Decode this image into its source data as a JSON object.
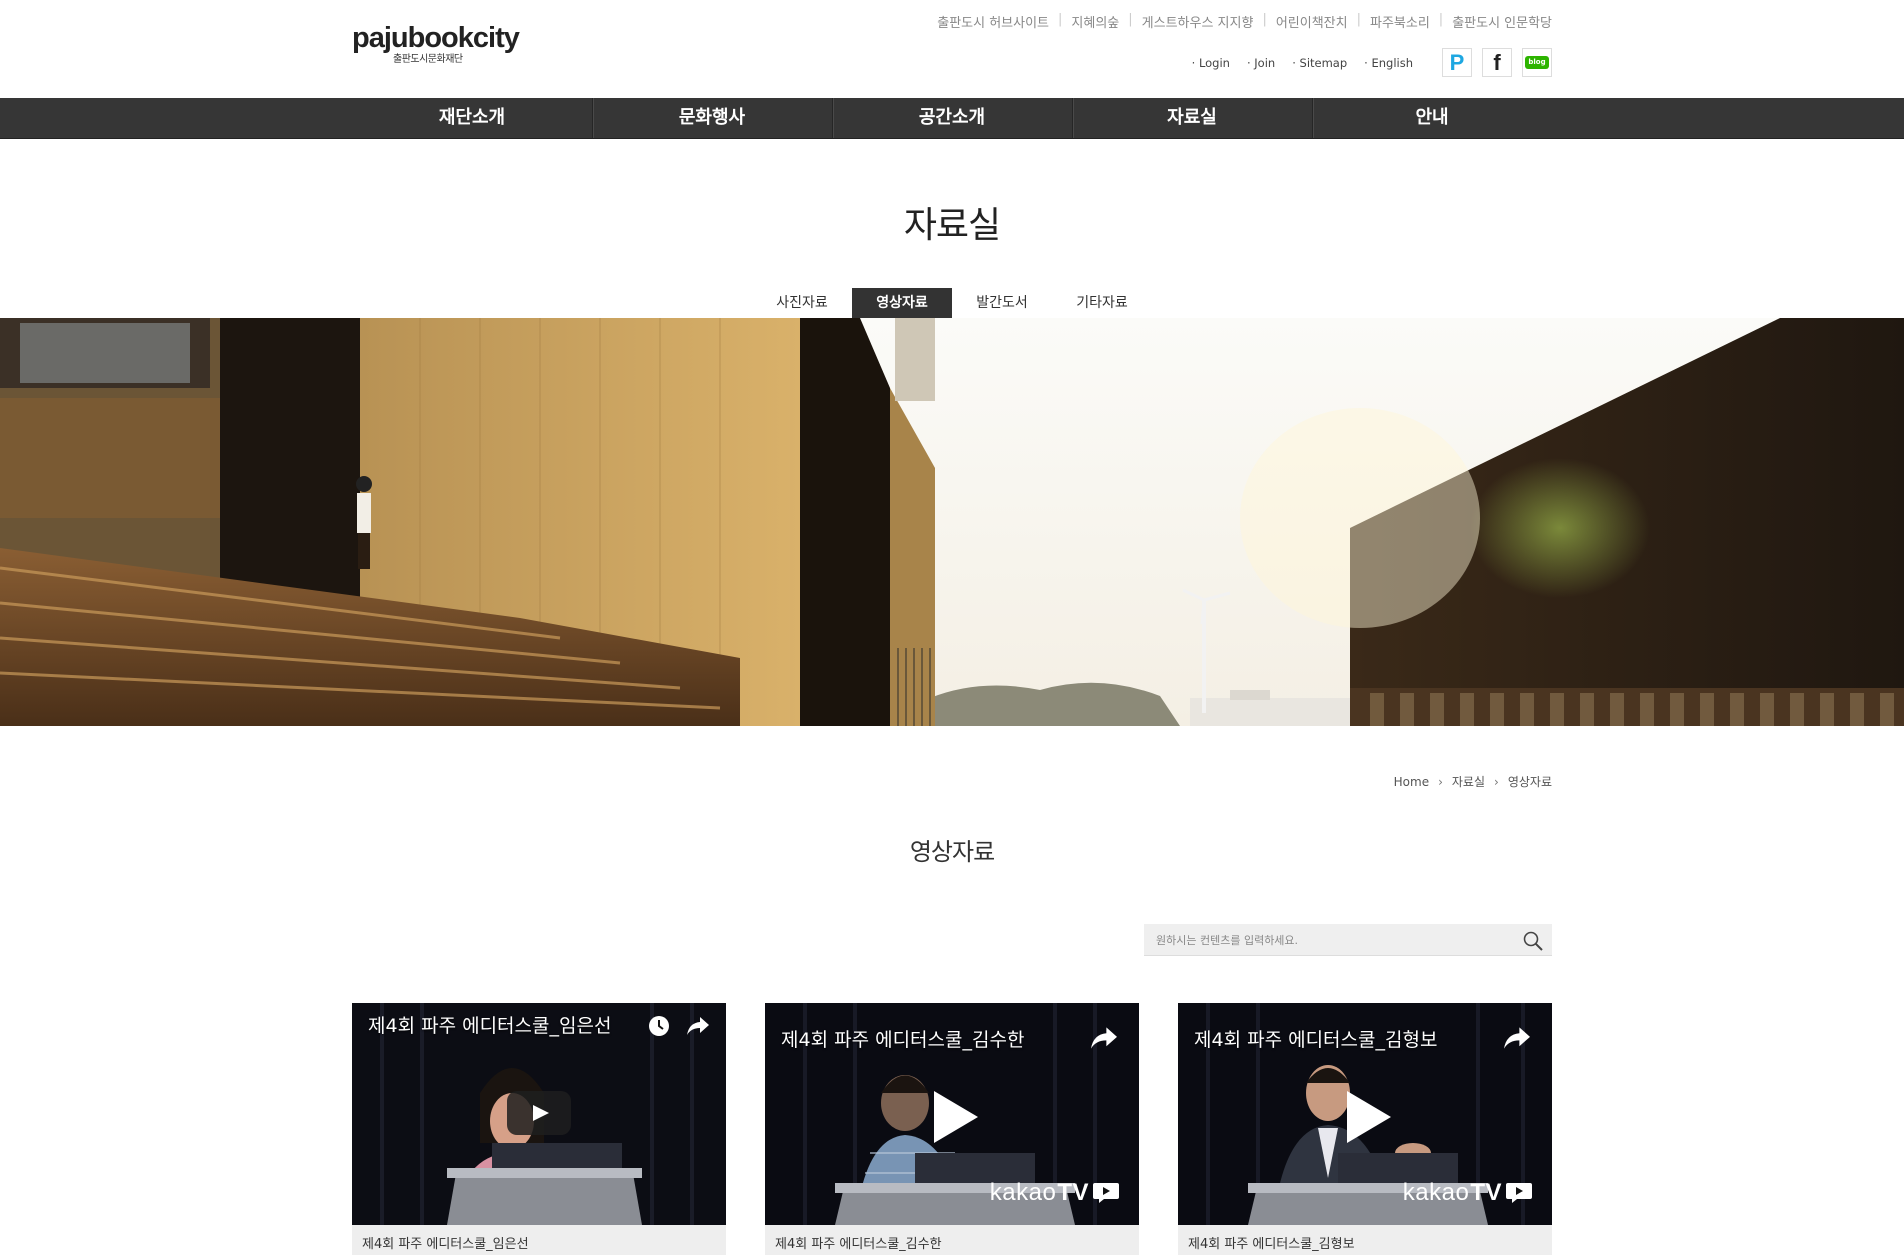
{
  "header": {
    "logo_main": "pajubookcity",
    "logo_sub": "출판도시문화재단",
    "top_links": [
      "출판도시 허브사이트",
      "지혜의숲",
      "게스트하우스 지지향",
      "어린이책잔치",
      "파주북소리",
      "출판도시 인문학당"
    ],
    "util_links": {
      "login": "Login",
      "join": "Join",
      "sitemap": "Sitemap",
      "english": "English"
    },
    "sns": {
      "post": "P",
      "facebook": "f",
      "blog": "blog"
    }
  },
  "gnb": [
    "재단소개",
    "문화행사",
    "공간소개",
    "자료실",
    "안내"
  ],
  "page_title": "자료실",
  "tabs": [
    {
      "label": "사진자료",
      "active": false
    },
    {
      "label": "영상자료",
      "active": true
    },
    {
      "label": "발간도서",
      "active": false
    },
    {
      "label": "기타자료",
      "active": false
    }
  ],
  "breadcrumb": [
    "Home",
    "자료실",
    "영상자료"
  ],
  "section_title": "영상자료",
  "search": {
    "placeholder": "원하시는 컨텐츠를 입력하세요."
  },
  "videos": [
    {
      "video_title": "제4회 파주 에디터스쿨_임은선",
      "caption": "제4회 파주 에디터스쿨_임은선",
      "kakao": ""
    },
    {
      "video_title": "제4회 파주 에디터스쿨_김수한",
      "caption": "제4회 파주 에디터스쿨_김수한",
      "kakao": "kakao",
      "kakao_b": "TV"
    },
    {
      "video_title": "제4회 파주 에디터스쿨_김형보",
      "caption": "제4회 파주 에디터스쿨_김형보",
      "kakao": "kakao",
      "kakao_b": "TV"
    }
  ],
  "colors": {
    "gnb_bg": "#363636",
    "tab_active": "#333333",
    "card_caption_bg": "#eeeeee"
  }
}
